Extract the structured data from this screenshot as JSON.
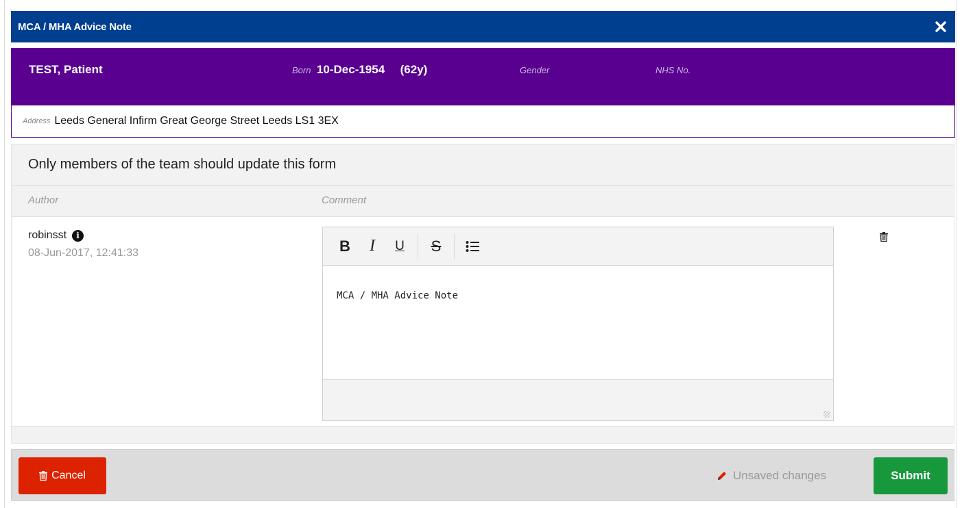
{
  "dialog": {
    "title": "MCA / MHA Advice Note",
    "close_icon": "close-icon"
  },
  "patient": {
    "name": "TEST, Patient",
    "born_label": "Born",
    "born_value": "10-Dec-1954",
    "age": "(62y)",
    "gender_label": "Gender",
    "nhs_label": "NHS No.",
    "address_label": "Address",
    "address_value": "Leeds General Infirm Great George Street Leeds LS1 3EX"
  },
  "form": {
    "heading": "Only members of the team should update this form",
    "author_header": "Author",
    "comment_header": "Comment",
    "entry": {
      "author": "robinsst",
      "timestamp": "08-Jun-2017, 12:41:33",
      "comment_text": "MCA / MHA Advice Note"
    },
    "toolbar": {
      "bold": "B",
      "italic": "I",
      "underline": "U",
      "strike": "S",
      "list_icon": "bullet-list-icon"
    }
  },
  "footer": {
    "cancel_label": "Cancel",
    "unsaved_label": "Unsaved changes",
    "submit_label": "Submit"
  },
  "colors": {
    "titlebar": "#003e8f",
    "patient_banner": "#5a0091",
    "cancel": "#dd2200",
    "submit": "#17983c"
  }
}
